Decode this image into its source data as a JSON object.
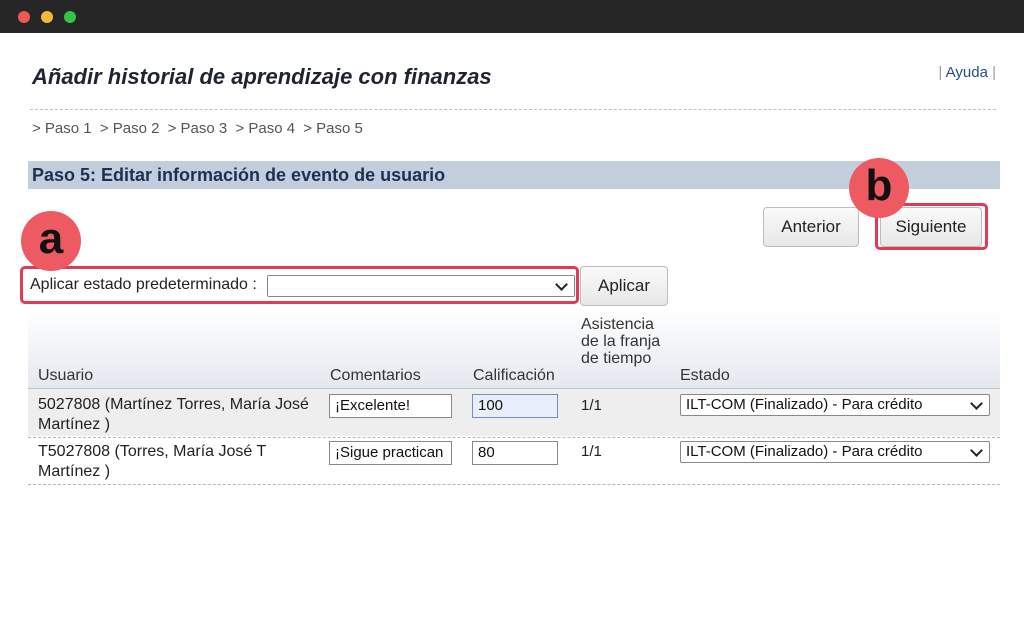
{
  "page": {
    "title": "Añadir historial de aprendizaje con finanzas",
    "help_sep_left": "|",
    "help": "Ayuda",
    "help_sep_right": "|"
  },
  "breadcrumb": [
    "> Paso 1",
    "> Paso 2",
    "> Paso 3",
    "> Paso 4",
    "> Paso 5"
  ],
  "section": {
    "title": "Paso 5: Editar información de evento de usuario"
  },
  "nav": {
    "previous": "Anterior",
    "next": "Siguiente"
  },
  "annotations": {
    "a": "a",
    "b": "b",
    "accent_color": "#e03a54"
  },
  "default_state": {
    "label": "Aplicar estado predeterminado :",
    "value": "",
    "apply": "Aplicar"
  },
  "table": {
    "headers": {
      "user": "Usuario",
      "comments": "Comentarios",
      "grade": "Calificación",
      "attendance": "Asistencia de la franja de tiempo",
      "state": "Estado"
    },
    "rows": [
      {
        "user": "5027808 (Martínez Torres, María José Martínez )",
        "comment": "¡Excelente!",
        "grade": "100",
        "attendance": "1/1",
        "state": "ILT-COM (Finalizado) - Para crédito"
      },
      {
        "user": "T5027808 (Torres, María José T Martínez )",
        "comment": "¡Sigue practican",
        "grade": "80",
        "attendance": "1/1",
        "state": "ILT-COM (Finalizado) - Para crédito"
      }
    ]
  }
}
